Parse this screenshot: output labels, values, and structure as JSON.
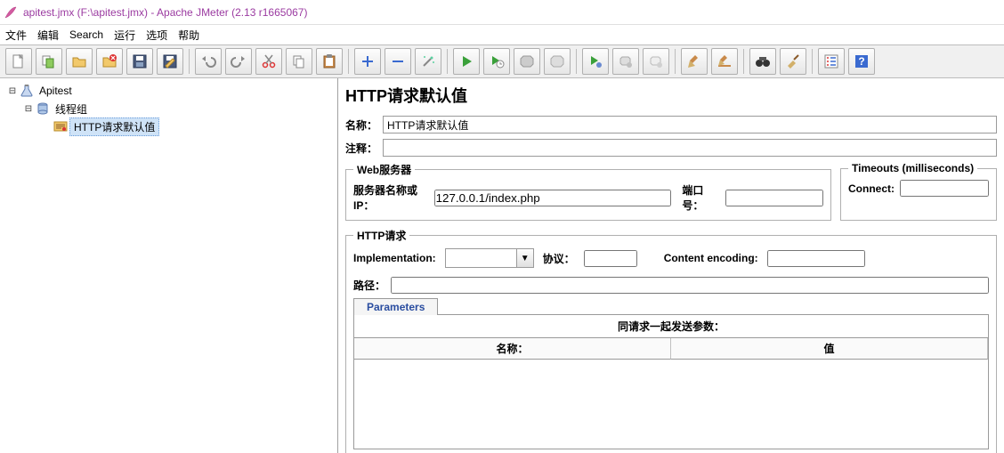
{
  "window": {
    "title": "apitest.jmx (F:\\apitest.jmx) - Apache JMeter (2.13 r1665067)"
  },
  "menu": {
    "file": "文件",
    "edit": "编辑",
    "search": "Search",
    "run": "运行",
    "options": "选项",
    "help": "帮助"
  },
  "tree": {
    "root": "Apitest",
    "group": "线程组",
    "http_defaults": "HTTP请求默认值"
  },
  "panel": {
    "heading": "HTTP请求默认值",
    "name_label": "名称：",
    "name_value": "HTTP请求默认值",
    "comment_label": "注释：",
    "comment_value": ""
  },
  "webserver": {
    "legend": "Web服务器",
    "server_label": "服务器名称或IP：",
    "server_value": "127.0.0.1/index.php",
    "port_label": "端口号：",
    "port_value": ""
  },
  "timeouts": {
    "legend": "Timeouts (milliseconds)",
    "connect_label": "Connect:",
    "connect_value": ""
  },
  "httpreq": {
    "legend": "HTTP请求",
    "impl_label": "Implementation:",
    "impl_value": "",
    "proto_label": "协议：",
    "proto_value": "",
    "enc_label": "Content encoding:",
    "enc_value": "",
    "path_label": "路径：",
    "path_value": ""
  },
  "params": {
    "tab": "Parameters",
    "title": "同请求一起发送参数：",
    "col_name": "名称：",
    "col_value": "值"
  }
}
